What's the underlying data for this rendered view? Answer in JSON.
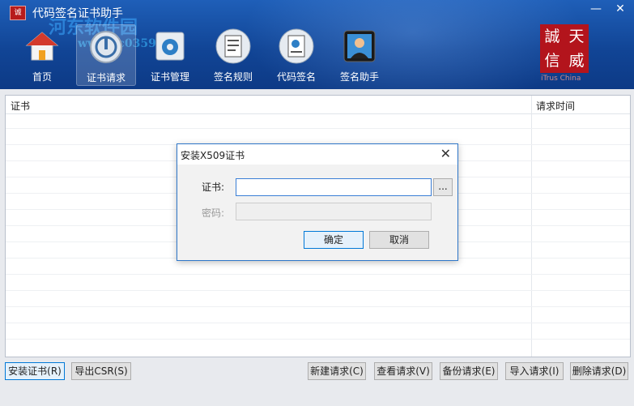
{
  "window": {
    "title": "代码签名证书助手",
    "app_icon_text": "诚",
    "controls": {
      "minimize": "—",
      "close": "✕"
    }
  },
  "watermark": {
    "line1": "河东软件园",
    "line2": "www.pc0359.cn"
  },
  "toolbar": {
    "items": [
      {
        "label": "首页",
        "icon": "home-icon",
        "active": false
      },
      {
        "label": "证书请求",
        "icon": "certificate-request-icon",
        "active": true
      },
      {
        "label": "证书管理",
        "icon": "gear-folder-icon",
        "active": false
      },
      {
        "label": "签名规则",
        "icon": "document-rules-icon",
        "active": false
      },
      {
        "label": "代码签名",
        "icon": "code-sign-icon",
        "active": false
      },
      {
        "label": "签名助手",
        "icon": "assistant-icon",
        "active": false
      }
    ]
  },
  "logo": {
    "chars": [
      "誠",
      "天",
      "信",
      "威"
    ],
    "sub": "iTrus China"
  },
  "grid": {
    "columns": [
      "证书",
      "请求时间"
    ],
    "rows": []
  },
  "dialog": {
    "title": "安装X509证书",
    "close": "✕",
    "cert_label": "证书:",
    "cert_value": "",
    "password_label": "密码:",
    "browse_label": "...",
    "ok_label": "确定",
    "cancel_label": "取消"
  },
  "bottom_buttons": {
    "install": "安装证书(R)",
    "export": "导出CSR(S)",
    "new": "新建请求(C)",
    "view": "查看请求(V)",
    "backup": "备份请求(E)",
    "import": "导入请求(I)",
    "delete": "删除请求(D)"
  },
  "colors": {
    "header": "#114596",
    "accent": "#2e76c8",
    "logo": "#b3141c"
  }
}
